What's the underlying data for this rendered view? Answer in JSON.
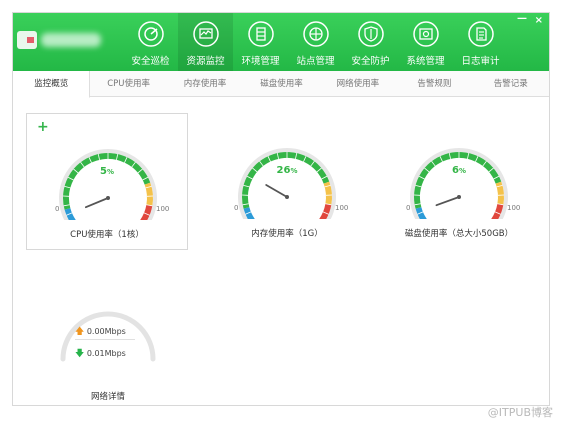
{
  "window": {
    "minimize_label": "—",
    "close_label": "×"
  },
  "nav": {
    "items": [
      {
        "label": "安全巡检",
        "icon": "patrol-icon"
      },
      {
        "label": "资源监控",
        "icon": "monitor-icon",
        "active": true
      },
      {
        "label": "环境管理",
        "icon": "environment-icon"
      },
      {
        "label": "站点管理",
        "icon": "site-icon"
      },
      {
        "label": "安全防护",
        "icon": "shield-icon"
      },
      {
        "label": "系统管理",
        "icon": "system-icon"
      },
      {
        "label": "日志审计",
        "icon": "log-icon"
      }
    ]
  },
  "tabs": [
    {
      "label": "监控概览",
      "active": true
    },
    {
      "label": "CPU使用率"
    },
    {
      "label": "内存使用率"
    },
    {
      "label": "磁盘使用率"
    },
    {
      "label": "网络使用率"
    },
    {
      "label": "告警规则"
    },
    {
      "label": "告警记录"
    }
  ],
  "gauges": {
    "cpu": {
      "value": "5",
      "unit": "%",
      "min": "0",
      "max": "100",
      "title": "CPU使用率（1核）",
      "percent": 5
    },
    "mem": {
      "value": "26",
      "unit": "%",
      "min": "0",
      "max": "100",
      "title": "内存使用率（1G）",
      "percent": 26
    },
    "disk": {
      "value": "6",
      "unit": "%",
      "min": "0",
      "max": "100",
      "title": "磁盘使用率（总大小50GB）",
      "percent": 6
    }
  },
  "network": {
    "up": "0.00Mbps",
    "down": "0.01Mbps",
    "up_arrow": "🡅",
    "down_arrow": "🡇",
    "title": "网络详情"
  },
  "card_add_label": "+",
  "watermark": "@ITPUB博客",
  "colors": {
    "brand_green": "#2cc24f",
    "gauge_green": "#34b547",
    "gauge_yellow": "#f4c24a",
    "gauge_orange": "#f0951e",
    "gauge_red": "#e0473d",
    "gauge_blue": "#2c9bd8"
  }
}
